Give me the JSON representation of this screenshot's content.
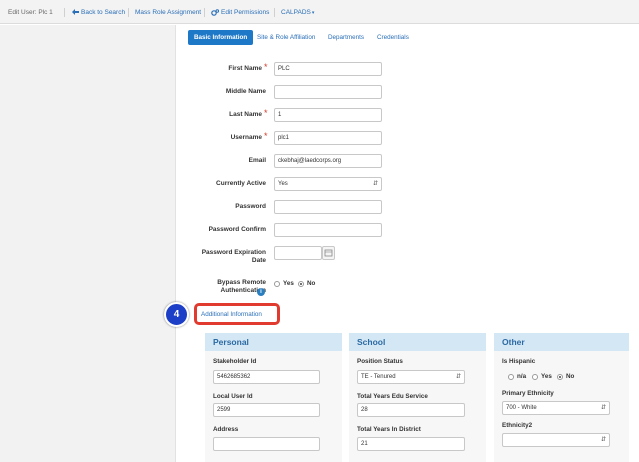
{
  "topbar": {
    "title": "Edit User: Plc 1",
    "back": "Back to Search",
    "mass_role": "Mass Role Assignment",
    "edit_permissions": "Edit Permissions",
    "calpads": "CALPADS",
    "calpads_caret": "▾"
  },
  "tabs": {
    "basic": "Basic Information",
    "site_role": "Site & Role Affiliation",
    "departments": "Departments",
    "credentials": "Credentials"
  },
  "form": {
    "first_name": {
      "label": "First Name",
      "value": "PLC"
    },
    "middle_name": {
      "label": "Middle Name",
      "value": ""
    },
    "last_name": {
      "label": "Last Name",
      "value": "1"
    },
    "username": {
      "label": "Username",
      "value": "plc1"
    },
    "email": {
      "label": "Email",
      "value": "ckebhaj@laedcorps.org"
    },
    "currently_active": {
      "label": "Currently Active",
      "value": "Yes"
    },
    "password": {
      "label": "Password",
      "value": ""
    },
    "password_confirm": {
      "label": "Password Confirm",
      "value": ""
    },
    "password_expiration": {
      "label": "Password Expiration Date",
      "value": ""
    },
    "bypass": {
      "label": "Bypass Remote Authentication",
      "yes": "Yes",
      "no": "No",
      "selected": "No"
    },
    "required_mark": "*",
    "info_glyph": "i"
  },
  "step_badge": "4",
  "additional_info_link": "Additional Information",
  "sections": {
    "personal": {
      "title": "Personal",
      "stakeholder_id": {
        "label": "Stakeholder Id",
        "value": "5462685362"
      },
      "local_user_id": {
        "label": "Local User Id",
        "value": "2599"
      },
      "address": {
        "label": "Address",
        "value": ""
      }
    },
    "school": {
      "title": "School",
      "position_status": {
        "label": "Position Status",
        "value": "TE - Tenured"
      },
      "total_years_edu": {
        "label": "Total Years Edu Service",
        "value": "28"
      },
      "total_years_district": {
        "label": "Total Years In District",
        "value": "21"
      }
    },
    "other": {
      "title": "Other",
      "is_hispanic": {
        "label": "Is Hispanic",
        "options": [
          "n/a",
          "Yes",
          "No"
        ],
        "selected": "No"
      },
      "primary_ethnicity": {
        "label": "Primary Ethnicity",
        "value": "700 - White"
      },
      "ethnicity2": {
        "label": "Ethnicity2",
        "value": ""
      }
    }
  },
  "colors": {
    "accent": "#1e78c8",
    "required": "#d23a2a",
    "highlight": "#e03b2e",
    "badge": "#1d3ec6",
    "section_header": "#d4e7f5"
  }
}
